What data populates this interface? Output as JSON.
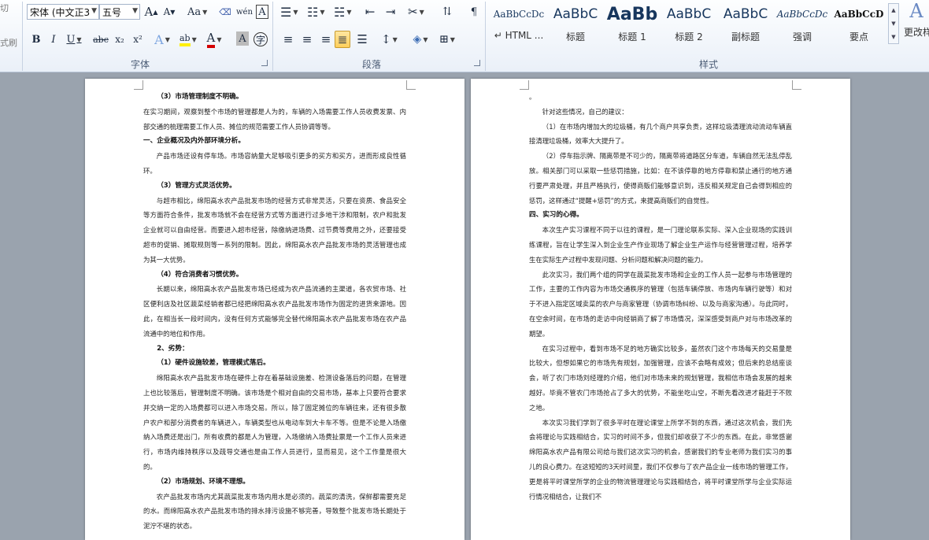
{
  "clipboard": {
    "cut_label": "切",
    "painter_label": "式刷"
  },
  "font_group": {
    "font_name": "宋体 (中文正3",
    "font_size": "五号",
    "label": "字体",
    "grow": "A",
    "shrink": "A",
    "case": "Aa",
    "phonetic": "wén",
    "char_border": "A",
    "bold": "B",
    "italic": "I",
    "underline": "U",
    "strike": "abc",
    "sub": "x₂",
    "sup": "x²",
    "effects": "A",
    "highlight": "ab",
    "color": "A",
    "shade": "A",
    "circle": "字"
  },
  "paragraph_group": {
    "label": "段落"
  },
  "styles_group": {
    "label": "样式",
    "items": [
      {
        "preview": "AaBbCcDc",
        "name": "↵ HTML ..."
      },
      {
        "preview": "AaBbC",
        "name": "标题"
      },
      {
        "preview": "AaBb",
        "name": "标题 1"
      },
      {
        "preview": "AaBbC",
        "name": "标题 2"
      },
      {
        "preview": "AaBbC",
        "name": "副标题"
      },
      {
        "preview": "AaBbCcDc",
        "name": "强调"
      },
      {
        "preview": "AaBbCcD",
        "name": "要点"
      }
    ],
    "change_label": "更改样"
  },
  "page1": [
    {
      "t": "h",
      "text": "（3）市场管理制度不明确。"
    },
    {
      "t": "pn",
      "text": "在实习期间，观察到整个市场的管理都是人为的，车辆的入场需要工作人员收费发票、内部交通的梳理需要工作人员、摊位的规范需要工作人员协调等等。"
    },
    {
      "t": "h0",
      "text": "一、企业概况及内外部环境分析。"
    },
    {
      "t": "p",
      "text": "产品市场还设有停车场。市场容纳量大足够吸引更多的买方和买方，进而形成良性循环。"
    },
    {
      "t": "h",
      "text": "（3）管理方式灵活优势。"
    },
    {
      "t": "p",
      "text": "与超市相比，绵阳高水农产品批发市场的经营方式非常灵活，只要在资质、食品安全等方面符合条件，批发市场就不会在经营方式等方面进行过多地干涉和限制，农户和批发企业就可以自由经营。而要进入超市经营，除缴纳进场费、过节费等费用之外，还要接受超市的促销、摊取规则等一系列的限制。因此，绵阳高水农产品批发市场的灵活管理也成为其一大优势。"
    },
    {
      "t": "h",
      "text": "（4）符合消费者习惯优势。"
    },
    {
      "t": "p",
      "text": "长期以来，绵阳高水农产品批发市场已经成为农产品流通的主渠道，各农贸市场、社区便利店及社区蔬菜经销者都已经把绵阳高水农产品批发市场作为固定的进货来源地。因此，在相当长一段时间内，没有任何方式能够完全替代绵阳高水农产品批发市场在农产品流通中的地位和作用。"
    },
    {
      "t": "h",
      "text": "2、劣势："
    },
    {
      "t": "h",
      "text": "（1）硬件设施较差，管理模式落后。"
    },
    {
      "t": "p",
      "text": "绵阳高水农产品批发市场在硬件上存在着基础设施差、检测设备落后的问题，在管理上也比较落后，管理制度不明确。该市场是个相对自由的交易市场，基本上只要符合要求并交纳一定的入场费都可以进入市场交易。所以，除了固定摊位的车辆往来，还有很多散户农户和部分消费者的车辆进入，车辆类型也从电动车到大卡车不等。但是不论是入场缴纳入场费还是出门，所有收费的都是人为管理，入场缴纳入场费扯票是一个工作人员来进行，市场内维持秩序以及疏导交通也是由工作人员进行，显而易见，这个工作量是很大的。"
    },
    {
      "t": "h",
      "text": "（2）市场规划、环境不理想。"
    },
    {
      "t": "p",
      "text": "农产品批发市场内尤其蔬菜批发市场内用水是必须的。蔬菜的清洗，保鲜都需要充足的水。而绵阳高水农产品批发市场的排水排污设施不够完善，导致整个批发市场长期处于泥泞不堪的状态。"
    }
  ],
  "page2": [
    {
      "t": "pn",
      "text": "。"
    },
    {
      "t": "p",
      "text": "针对这些情况，自己的建议："
    },
    {
      "t": "p",
      "text": "（1）在市场内增加大的垃圾桶，有几个商户共享负责，这样垃圾清理流动流动车辆直接清理垃圾桶，效率大大提升了。"
    },
    {
      "t": "p",
      "text": "（2）停车指示牌、隔离带是不可少的，隔离带将道路区分车道，车辆自然无法乱停乱放。相关部门可以采取一些惩罚措施，比如：在不该停靠的地方停靠和禁止通行的地方通行要严肃处理，并且严格执行，使得商贩们能够意识到，违反相关规定自己会得到相应的惩罚，这样通过“提醒+惩罚”的方式，来提高商贩们的自觉性。"
    },
    {
      "t": "h0",
      "text": "四、实习的心得。"
    },
    {
      "t": "p",
      "text": "本次生产实习课程不同于以往的课程，是一门理论联系实际、深入企业现场的实践训练课程，旨在让学生深入到企业生产作业现场了解企业生产运作与经营管理过程，培养学生在实际生产过程中发现问题、分析问题和解决问题的能力。"
    },
    {
      "t": "p",
      "text": "此次实习，我们两个组的同学在蔬菜批发市场和企业的工作人员一起参与市场管理的工作，主要的工作内容为市场交通秩序的管理（包括车辆停放、市场内车辆行驶等）和对于不进入指定区域卖菜的农户与商家管理（协调市场纠纷、以及与商家沟通）。与此同时，在空余时间，在市场的走访中向经销商了解了市场情况，深深感受到商户对与市场改革的期望。"
    },
    {
      "t": "p",
      "text": "在实习过程中，看到市场不足的地方确实比较多，虽然农门这个市场每天的交易量是比较大，但想如果它的市场先有规划，加强管理，应该不会略有成效；但后来的总结座谈会，听了农门市场刘经理的介绍，他们对市场未来的规划管理，我相信市场会发展的越来越好。毕竟不管农门市场抢占了多大的优势，不能坐吃山空，不断先看改进才能赶于不败之地。"
    },
    {
      "t": "p",
      "text": "本次实习我们学到了很多平时在理论课堂上所学不到的东西，通过这次机会，我们先会将理论与实践相结合，实习的时间不多，但我们却收获了不少的东西。在此，非常感谢绵阳高水农产品有限公司给与我们这次实习的机会，感谢我们的专业老师为我们实习的事儿的良心费力。在这短短的3天时间里，我们不仅参与了农产品企业一线市场的管理工作，更是将平时课堂所学的企业的物流管理理论与实践相结合，将平时课堂所学与企业实际运行情况相结合，让我们不"
    }
  ]
}
